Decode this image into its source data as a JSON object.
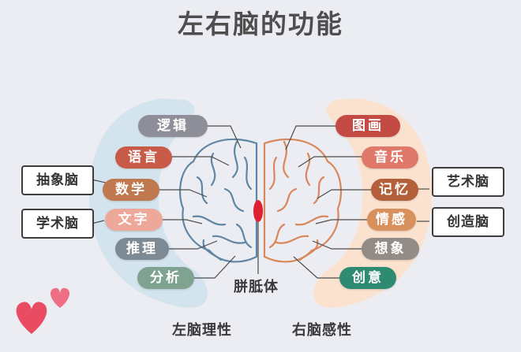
{
  "title": "左右脑的功能",
  "left_brain": {
    "caption": "左脑理性",
    "functions": [
      "逻辑",
      "语言",
      "数学",
      "文字",
      "推理",
      "分析"
    ],
    "categories": [
      "抽象脑",
      "学术脑"
    ]
  },
  "right_brain": {
    "caption": "右脑感性",
    "functions": [
      "图画",
      "音乐",
      "记忆",
      "情感",
      "想象",
      "创意"
    ],
    "categories": [
      "艺术脑",
      "创造脑"
    ]
  },
  "center_label": "胼胝体",
  "colors": {
    "background": "#ecedf3",
    "left_arc": "#d3e4ee",
    "right_arc": "#fbe2cf",
    "left_brain_stroke": "#5f87a3",
    "right_brain_stroke": "#d9875a",
    "corpus_callosum": "#e0202f",
    "heart": "#e84b62",
    "pills": [
      "#8e8e98",
      "#c85a48",
      "#c0784e",
      "#eea89a",
      "#7d8a93",
      "#7fa390",
      "#c44a44",
      "#e0786a",
      "#b3603a",
      "#d8905d",
      "#938c86",
      "#2e8a70"
    ]
  }
}
